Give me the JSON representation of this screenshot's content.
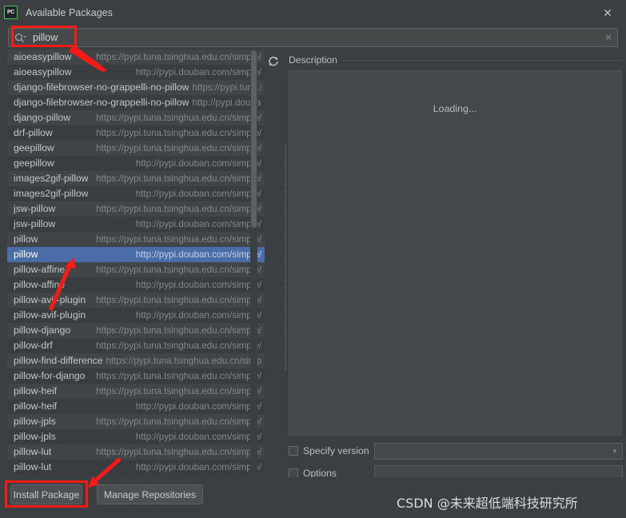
{
  "window": {
    "title": "Available Packages",
    "logo_icon": "pycharm-logo-icon",
    "close_icon": "close-icon"
  },
  "search": {
    "icon": "search-icon",
    "value": "pillow",
    "placeholder": "",
    "clear_icon": "close-icon"
  },
  "toolbar": {
    "refresh_icon": "refresh-icon"
  },
  "list": {
    "selected_index": 13,
    "rows": [
      {
        "name": "aioeasypillow",
        "url": "https://pypi.tuna.tsinghua.edu.cn/simple/"
      },
      {
        "name": "aioeasypillow",
        "url": "http://pypi.douban.com/simple/"
      },
      {
        "name": "django-filebrowser-no-grappelli-no-pillow",
        "url": "https://pypi.tuna.tsinghua.edu.cn/simple/"
      },
      {
        "name": "django-filebrowser-no-grappelli-no-pillow",
        "url": "http://pypi.douban.com/simple/"
      },
      {
        "name": "django-pillow",
        "url": "https://pypi.tuna.tsinghua.edu.cn/simple/"
      },
      {
        "name": "drf-pillow",
        "url": "https://pypi.tuna.tsinghua.edu.cn/simple/"
      },
      {
        "name": "geepillow",
        "url": "https://pypi.tuna.tsinghua.edu.cn/simple/"
      },
      {
        "name": "geepillow",
        "url": "http://pypi.douban.com/simple/"
      },
      {
        "name": "images2gif-pillow",
        "url": "https://pypi.tuna.tsinghua.edu.cn/simple/"
      },
      {
        "name": "images2gif-pillow",
        "url": "http://pypi.douban.com/simple/"
      },
      {
        "name": "jsw-pillow",
        "url": "https://pypi.tuna.tsinghua.edu.cn/simple/"
      },
      {
        "name": "jsw-pillow",
        "url": "http://pypi.douban.com/simple/"
      },
      {
        "name": "pillow",
        "url": "https://pypi.tuna.tsinghua.edu.cn/simple/"
      },
      {
        "name": "pillow",
        "url": "http://pypi.douban.com/simple/"
      },
      {
        "name": "pillow-affine",
        "url": "https://pypi.tuna.tsinghua.edu.cn/simple/"
      },
      {
        "name": "pillow-affine",
        "url": "http://pypi.douban.com/simple/"
      },
      {
        "name": "pillow-avif-plugin",
        "url": "https://pypi.tuna.tsinghua.edu.cn/simple/"
      },
      {
        "name": "pillow-avif-plugin",
        "url": "http://pypi.douban.com/simple/"
      },
      {
        "name": "pillow-django",
        "url": "https://pypi.tuna.tsinghua.edu.cn/simple/"
      },
      {
        "name": "pillow-drf",
        "url": "https://pypi.tuna.tsinghua.edu.cn/simple/"
      },
      {
        "name": "pillow-find-difference",
        "url": "https://pypi.tuna.tsinghua.edu.cn/simple/"
      },
      {
        "name": "pillow-for-django",
        "url": "https://pypi.tuna.tsinghua.edu.cn/simple/"
      },
      {
        "name": "pillow-heif",
        "url": "https://pypi.tuna.tsinghua.edu.cn/simple/"
      },
      {
        "name": "pillow-heif",
        "url": "http://pypi.douban.com/simple/"
      },
      {
        "name": "pillow-jpls",
        "url": "https://pypi.tuna.tsinghua.edu.cn/simple/"
      },
      {
        "name": "pillow-jpls",
        "url": "http://pypi.douban.com/simple/"
      },
      {
        "name": "pillow-lut",
        "url": "https://pypi.tuna.tsinghua.edu.cn/simple/"
      },
      {
        "name": "pillow-lut",
        "url": "http://pypi.douban.com/simple/"
      }
    ]
  },
  "description": {
    "title": "Description",
    "content": "Loading..."
  },
  "options": {
    "specify_version_label": "Specify version",
    "specify_version_value": "",
    "specify_version_checked": false,
    "options_label": "Options",
    "options_value": "",
    "options_checked": false
  },
  "buttons": {
    "install": "Install Package",
    "manage": "Manage Repositories"
  },
  "watermark": "CSDN @未来超低端科技研究所",
  "colors": {
    "background": "#3c3f41",
    "selection": "#4a6da7",
    "annotation": "#f91a16",
    "text": "#bcbfc1"
  }
}
